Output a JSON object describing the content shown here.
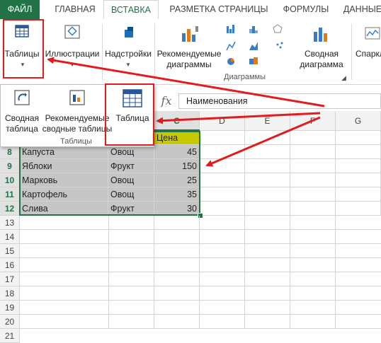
{
  "tabs": {
    "file": "ФАЙЛ",
    "home": "ГЛАВНАЯ",
    "insert": "ВСТАВКА",
    "layout": "РАЗМЕТКА СТРАНИЦЫ",
    "formulas": "ФОРМУЛЫ",
    "data": "ДАННЫЕ"
  },
  "ribbon": {
    "tables": "Таблицы",
    "illustrations": "Иллюстрации",
    "addins": "Надстройки",
    "recommended_charts_1": "Рекомендуемые",
    "recommended_charts_2": "диаграммы",
    "pivot_chart_1": "Сводная",
    "pivot_chart_2": "диаграмма",
    "sparklines": "Спаркл",
    "charts_group": "Диаграммы"
  },
  "panel": {
    "pivot_table_1": "Сводная",
    "pivot_table_2": "таблица",
    "recommended_pivot_1": "Рекомендуемые",
    "recommended_pivot_2": "сводные таблицы",
    "table": "Таблица",
    "group_label": "Таблицы"
  },
  "formula_bar": {
    "fx": "fx",
    "content": "Наименования"
  },
  "grid": {
    "columns": [
      "C",
      "D",
      "E",
      "F",
      "G"
    ],
    "header_cell": "Цена",
    "rows": [
      {
        "num": "8",
        "name": "Капуста",
        "type": "Овощ",
        "price": "45"
      },
      {
        "num": "9",
        "name": "Яблоки",
        "type": "Фрукт",
        "price": "150"
      },
      {
        "num": "10",
        "name": "Марковь",
        "type": "Овощ",
        "price": "25"
      },
      {
        "num": "11",
        "name": "Картофель",
        "type": "Овощ",
        "price": "35"
      },
      {
        "num": "12",
        "name": "Слива",
        "type": "Фрукт",
        "price": "30"
      }
    ],
    "empty_rows": [
      "13",
      "14",
      "15",
      "16",
      "17",
      "18",
      "19",
      "20",
      "21"
    ]
  },
  "colors": {
    "accent": "#217346",
    "highlight": "#e21c1c",
    "header_fill": "#c8c800"
  }
}
